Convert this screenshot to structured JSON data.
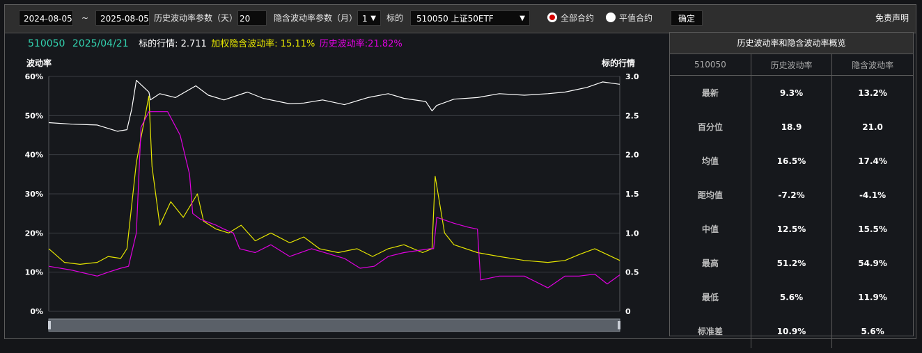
{
  "toolbar": {
    "start_date": "2024-08-05",
    "separator": "~",
    "end_date": "2025-08-05",
    "hist_param_label": "历史波动率参数（天）",
    "hist_param_value": "20",
    "implied_param_label": "隐含波动率参数（月）",
    "implied_param_value": "1",
    "underlying_label": "标的",
    "underlying_value": "510050 上证50ETF",
    "radio_all": "全部合约",
    "radio_atm": "平值合约",
    "confirm": "确定",
    "disclaimer": "免责声明"
  },
  "info": {
    "code": "510050",
    "date": "2025/04/21",
    "price_label": "标的行情: 2.711",
    "iv_label": "加权隐含波动率: 15.11%",
    "hv_label": "历史波动率:21.82%"
  },
  "colors": {
    "code": "#32d3b0",
    "price_line": "#ffffff",
    "iv": "#e6e600",
    "hv": "#e000e0",
    "grid": "#3a3d42"
  },
  "stats": {
    "title": "历史波动率和隐含波动率概览",
    "headers": [
      "510050",
      "历史波动率",
      "隐含波动率"
    ],
    "rows": [
      {
        "label": "最新",
        "hv": "9.3%",
        "iv": "13.2%"
      },
      {
        "label": "百分位",
        "hv": "18.9",
        "iv": "21.0"
      },
      {
        "label": "均值",
        "hv": "16.5%",
        "iv": "17.4%"
      },
      {
        "label": "距均值",
        "hv": "-7.2%",
        "iv": "-4.1%"
      },
      {
        "label": "中值",
        "hv": "12.5%",
        "iv": "15.5%"
      },
      {
        "label": "最高",
        "hv": "51.2%",
        "iv": "54.9%"
      },
      {
        "label": "最低",
        "hv": "5.6%",
        "iv": "11.9%"
      },
      {
        "label": "标准差",
        "hv": "10.9%",
        "iv": "5.6%"
      }
    ]
  },
  "chart_data": {
    "type": "line",
    "title": "",
    "ylabel_left": "波动率",
    "ylabel_right": "标的行情",
    "y_left_ticks": [
      "0%",
      "10%",
      "20%",
      "30%",
      "40%",
      "50%",
      "60%"
    ],
    "y_right_ticks": [
      "0",
      "0.5",
      "1.0",
      "1.5",
      "2.0",
      "2.5",
      "3.0"
    ],
    "ylim_left": [
      0,
      60
    ],
    "ylim_right": [
      0,
      3.0
    ],
    "x_range": [
      "2024-08-05",
      "2025-08-05"
    ],
    "grid": true,
    "series": [
      {
        "name": "标的行情",
        "axis": "right",
        "color": "#ffffff",
        "x": [
          "2024-08-05",
          "2024-08-20",
          "2024-09-05",
          "2024-09-18",
          "2024-09-24",
          "2024-09-27",
          "2024-09-30",
          "2024-10-08",
          "2024-10-09",
          "2024-10-15",
          "2024-10-25",
          "2024-11-07",
          "2024-11-15",
          "2024-11-25",
          "2024-12-10",
          "2024-12-20",
          "2025-01-06",
          "2025-01-15",
          "2025-01-27",
          "2025-02-10",
          "2025-02-25",
          "2025-03-10",
          "2025-03-20",
          "2025-04-03",
          "2025-04-07",
          "2025-04-10",
          "2025-04-21",
          "2025-05-06",
          "2025-05-20",
          "2025-06-05",
          "2025-06-20",
          "2025-07-01",
          "2025-07-15",
          "2025-07-25",
          "2025-08-05"
        ],
        "values": [
          2.41,
          2.39,
          2.38,
          2.3,
          2.32,
          2.58,
          2.95,
          2.8,
          2.7,
          2.78,
          2.73,
          2.88,
          2.76,
          2.7,
          2.8,
          2.72,
          2.65,
          2.66,
          2.7,
          2.64,
          2.73,
          2.78,
          2.72,
          2.68,
          2.56,
          2.63,
          2.71,
          2.73,
          2.78,
          2.76,
          2.78,
          2.8,
          2.86,
          2.93,
          2.9
        ]
      },
      {
        "name": "加权隐含波动率",
        "axis": "left",
        "color": "#e6e600",
        "x": [
          "2024-08-05",
          "2024-08-15",
          "2024-08-25",
          "2024-09-05",
          "2024-09-12",
          "2024-09-20",
          "2024-09-24",
          "2024-09-30",
          "2024-10-08",
          "2024-10-10",
          "2024-10-15",
          "2024-10-22",
          "2024-10-30",
          "2024-11-08",
          "2024-11-12",
          "2024-11-20",
          "2024-11-28",
          "2024-12-06",
          "2024-12-15",
          "2024-12-25",
          "2025-01-06",
          "2025-01-15",
          "2025-01-25",
          "2025-02-06",
          "2025-02-18",
          "2025-02-28",
          "2025-03-10",
          "2025-03-20",
          "2025-04-01",
          "2025-04-07",
          "2025-04-09",
          "2025-04-15",
          "2025-04-21",
          "2025-05-06",
          "2025-05-20",
          "2025-06-05",
          "2025-06-20",
          "2025-07-01",
          "2025-07-10",
          "2025-07-20",
          "2025-08-05"
        ],
        "values": [
          16.0,
          12.5,
          12.0,
          12.5,
          14.0,
          13.5,
          16.0,
          38.0,
          55.0,
          37.0,
          22.0,
          28.0,
          24.0,
          30.0,
          23.0,
          21.0,
          20.0,
          22.0,
          18.0,
          20.0,
          17.5,
          19.0,
          16.0,
          15.0,
          16.0,
          14.0,
          16.0,
          17.0,
          15.0,
          16.0,
          34.5,
          20.0,
          17.0,
          15.0,
          14.0,
          13.0,
          12.5,
          13.0,
          14.5,
          16.0,
          13.0
        ]
      },
      {
        "name": "历史波动率",
        "axis": "left",
        "color": "#e000e0",
        "x": [
          "2024-08-05",
          "2024-08-20",
          "2024-09-05",
          "2024-09-12",
          "2024-09-20",
          "2024-09-25",
          "2024-09-30",
          "2024-10-03",
          "2024-10-08",
          "2024-10-20",
          "2024-10-28",
          "2024-11-03",
          "2024-11-05",
          "2024-11-10",
          "2024-11-20",
          "2024-11-25",
          "2024-12-01",
          "2024-12-05",
          "2024-12-15",
          "2024-12-25",
          "2025-01-06",
          "2025-01-20",
          "2025-02-10",
          "2025-02-20",
          "2025-03-01",
          "2025-03-10",
          "2025-03-20",
          "2025-04-06",
          "2025-04-08",
          "2025-04-10",
          "2025-04-21",
          "2025-04-30",
          "2025-05-06",
          "2025-05-08",
          "2025-05-20",
          "2025-06-05",
          "2025-06-10",
          "2025-06-20",
          "2025-07-01",
          "2025-07-10",
          "2025-07-20",
          "2025-07-28",
          "2025-08-05"
        ],
        "values": [
          11.5,
          10.5,
          9.0,
          10.0,
          11.0,
          11.5,
          20.0,
          47.0,
          51.0,
          51.0,
          45.0,
          35.0,
          25.0,
          23.5,
          22.0,
          21.0,
          20.0,
          16.0,
          15.0,
          17.0,
          14.0,
          16.0,
          13.5,
          11.0,
          11.5,
          14.0,
          15.0,
          16.0,
          16.0,
          24.0,
          22.5,
          21.5,
          21.0,
          8.0,
          9.0,
          9.0,
          8.0,
          6.0,
          9.0,
          9.0,
          9.5,
          7.0,
          9.3
        ]
      }
    ]
  }
}
